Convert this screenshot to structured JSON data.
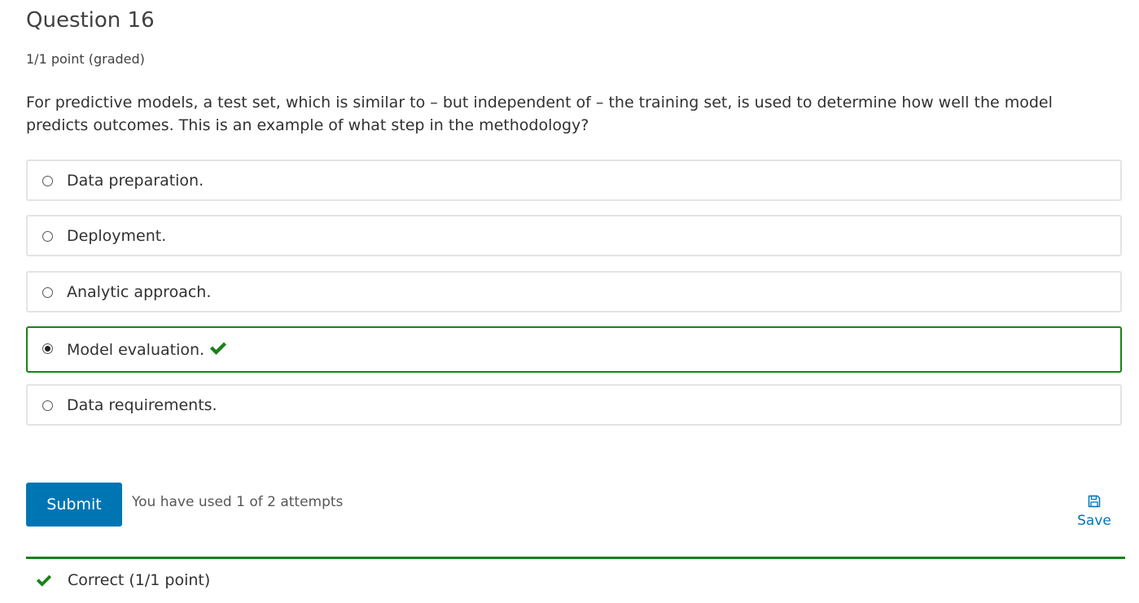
{
  "question": {
    "title": "Question 16",
    "points": "1/1 point (graded)",
    "prompt": "For predictive models, a test set, which is similar to – but independent of – the training set, is used to determine how well the model predicts outcomes. This is an example of what step in the methodology?"
  },
  "choices": [
    {
      "label": "Data preparation.",
      "selected": false
    },
    {
      "label": "Deployment.",
      "selected": false
    },
    {
      "label": "Analytic approach.",
      "selected": false
    },
    {
      "label": "Model evaluation.",
      "selected": true,
      "status": "correct"
    },
    {
      "label": "Data requirements.",
      "selected": false
    }
  ],
  "actions": {
    "submit_label": "Submit",
    "attempts_text": "You have used 1 of 2 attempts",
    "save_label": "Save"
  },
  "notification": {
    "text": "Correct (1/1 point)"
  },
  "colors": {
    "correct": "#198217",
    "primary": "#0075b4",
    "border": "#e4e4e4"
  },
  "icons": {
    "correct": "checkmark-icon",
    "save": "floppy-disk-icon",
    "radio": "radio-button-icon"
  }
}
